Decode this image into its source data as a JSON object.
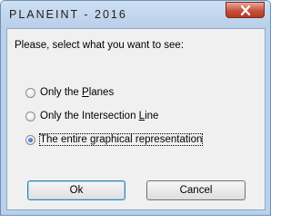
{
  "window": {
    "title": "PLANEINT - 2016"
  },
  "dialog": {
    "prompt": "Please, select what you want to see:",
    "options": [
      {
        "before": "Only the ",
        "mnemonic": "P",
        "after": "lanes",
        "checked": false
      },
      {
        "before": "Only the Intersection ",
        "mnemonic": "L",
        "after": "ine",
        "checked": false
      },
      {
        "before": "The entire ",
        "mnemonic": "g",
        "after": "raphical representation",
        "checked": true
      }
    ],
    "ok_label": "Ok",
    "cancel_label": "Cancel"
  },
  "icons": {
    "close": "close-icon"
  },
  "colors": {
    "close_button": "#c7513c",
    "radio_selected": "#1c4fb5",
    "window_frame": "#b9d1ea"
  }
}
